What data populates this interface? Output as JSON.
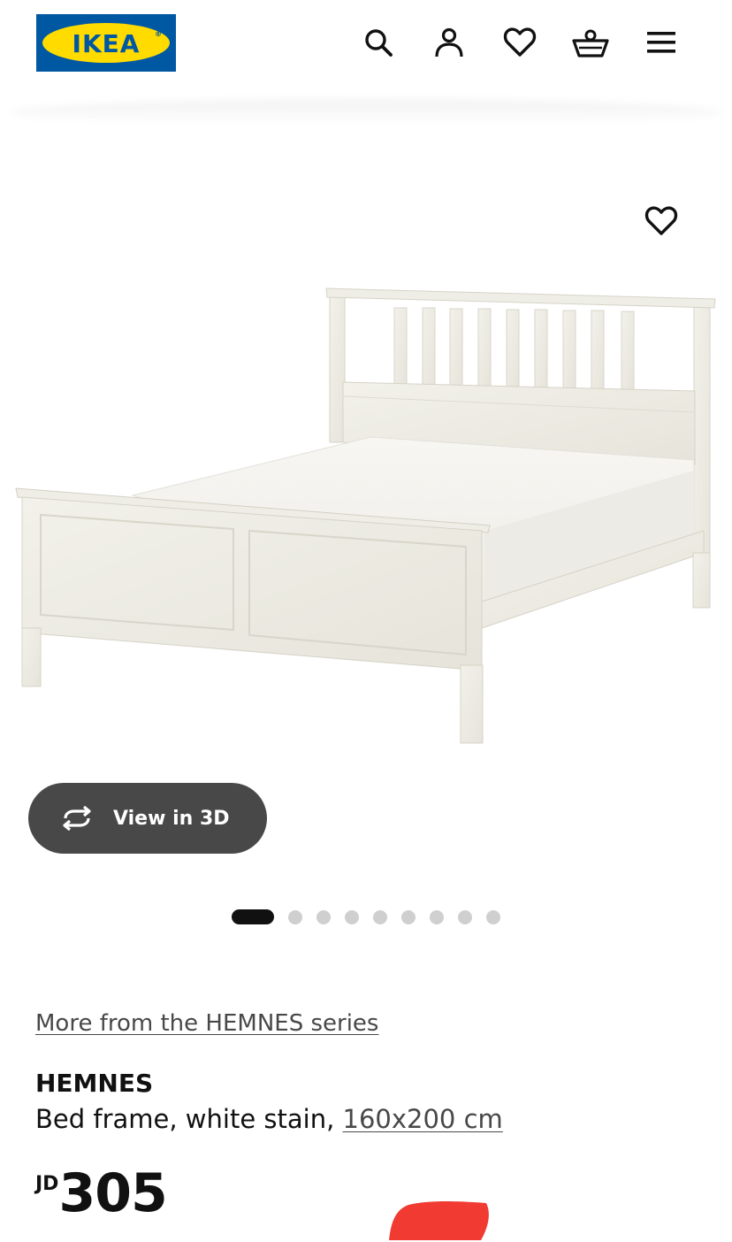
{
  "header": {
    "logo_text": "IKEA",
    "logo_registered": "®",
    "icons": [
      "search-icon",
      "account-icon",
      "heart-icon",
      "basket-icon",
      "menu-icon"
    ]
  },
  "product_image": {
    "view_3d_label": "View in 3D",
    "carousel": {
      "total": 9,
      "active_index": 0
    }
  },
  "product": {
    "series_link": "More from the HEMNES series",
    "name": "HEMNES",
    "description_prefix": "Bed frame, white stain, ",
    "size": "160x200 cm",
    "currency": "JD",
    "price": "305"
  },
  "colors": {
    "ikea_blue": "#0058A3",
    "ikea_yellow": "#FFDB00",
    "button_dark": "#484848",
    "dot_inactive": "#CFCFCF",
    "dot_active": "#111111"
  }
}
